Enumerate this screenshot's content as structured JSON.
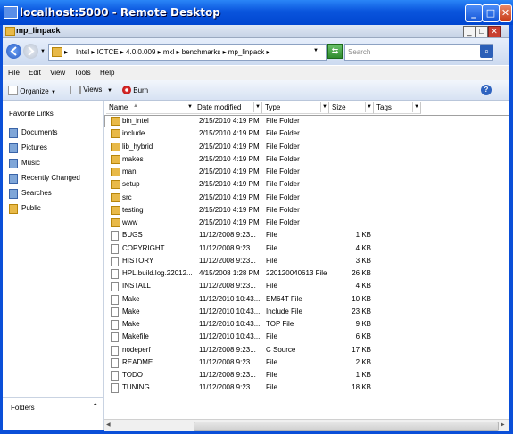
{
  "window": {
    "title": "localhost:5000 - Remote Desktop"
  },
  "explorer": {
    "title": "mp_linpack"
  },
  "address": {
    "crumbs": [
      "Intel",
      "ICTCE",
      "4.0.0.009",
      "mkl",
      "benchmarks",
      "mp_linpack"
    ],
    "crumb_text": "Intel  ▸  ICTCE  ▸  4.0.0.009  ▸  mkl  ▸  benchmarks  ▸  mp_linpack  ▸"
  },
  "search": {
    "placeholder": "Search"
  },
  "menu": {
    "file": "File",
    "edit": "Edit",
    "view": "View",
    "tools": "Tools",
    "help": "Help"
  },
  "commands": {
    "organize": "Organize",
    "views": "Views",
    "burn": "Burn"
  },
  "nav": {
    "favorites_header": "Favorite Links",
    "items": [
      "Documents",
      "Pictures",
      "Music",
      "Recently Changed",
      "Searches",
      "Public"
    ],
    "folders_label": "Folders"
  },
  "columns": {
    "name": "Name",
    "date": "Date modified",
    "type": "Type",
    "size": "Size",
    "tags": "Tags"
  },
  "files": [
    {
      "name": "bin_intel",
      "date": "2/15/2010 4:19 PM",
      "type": "File Folder",
      "size": "",
      "kind": "folder"
    },
    {
      "name": "include",
      "date": "2/15/2010 4:19 PM",
      "type": "File Folder",
      "size": "",
      "kind": "folder"
    },
    {
      "name": "lib_hybrid",
      "date": "2/15/2010 4:19 PM",
      "type": "File Folder",
      "size": "",
      "kind": "folder"
    },
    {
      "name": "makes",
      "date": "2/15/2010 4:19 PM",
      "type": "File Folder",
      "size": "",
      "kind": "folder"
    },
    {
      "name": "man",
      "date": "2/15/2010 4:19 PM",
      "type": "File Folder",
      "size": "",
      "kind": "folder"
    },
    {
      "name": "setup",
      "date": "2/15/2010 4:19 PM",
      "type": "File Folder",
      "size": "",
      "kind": "folder"
    },
    {
      "name": "src",
      "date": "2/15/2010 4:19 PM",
      "type": "File Folder",
      "size": "",
      "kind": "folder"
    },
    {
      "name": "testing",
      "date": "2/15/2010 4:19 PM",
      "type": "File Folder",
      "size": "",
      "kind": "folder"
    },
    {
      "name": "www",
      "date": "2/15/2010 4:19 PM",
      "type": "File Folder",
      "size": "",
      "kind": "folder"
    },
    {
      "name": "BUGS",
      "date": "11/12/2008 9:23...",
      "type": "File",
      "size": "1 KB",
      "kind": "file"
    },
    {
      "name": "COPYRIGHT",
      "date": "11/12/2008 9:23...",
      "type": "File",
      "size": "4 KB",
      "kind": "file"
    },
    {
      "name": "HISTORY",
      "date": "11/12/2008 9:23...",
      "type": "File",
      "size": "3 KB",
      "kind": "file"
    },
    {
      "name": "HPL.build.log.22012...",
      "date": "4/15/2008 1:28 PM",
      "type": "220120040613 File",
      "size": "26 KB",
      "kind": "file"
    },
    {
      "name": "INSTALL",
      "date": "11/12/2008 9:23...",
      "type": "File",
      "size": "4 KB",
      "kind": "file"
    },
    {
      "name": "Make",
      "date": "11/12/2010 10:43...",
      "type": "EM64T File",
      "size": "10 KB",
      "kind": "file"
    },
    {
      "name": "Make",
      "date": "11/12/2010 10:43...",
      "type": "Include File",
      "size": "23 KB",
      "kind": "file"
    },
    {
      "name": "Make",
      "date": "11/12/2010 10:43...",
      "type": "TOP File",
      "size": "9 KB",
      "kind": "file"
    },
    {
      "name": "Makefile",
      "date": "11/12/2010 10:43...",
      "type": "File",
      "size": "6 KB",
      "kind": "file"
    },
    {
      "name": "nodeperf",
      "date": "11/12/2008 9:23...",
      "type": "C Source",
      "size": "17 KB",
      "kind": "file"
    },
    {
      "name": "README",
      "date": "11/12/2008 9:23...",
      "type": "File",
      "size": "2 KB",
      "kind": "file"
    },
    {
      "name": "TODO",
      "date": "11/12/2008 9:23...",
      "type": "File",
      "size": "1 KB",
      "kind": "file"
    },
    {
      "name": "TUNING",
      "date": "11/12/2008 9:23...",
      "type": "File",
      "size": "18 KB",
      "kind": "file"
    }
  ]
}
